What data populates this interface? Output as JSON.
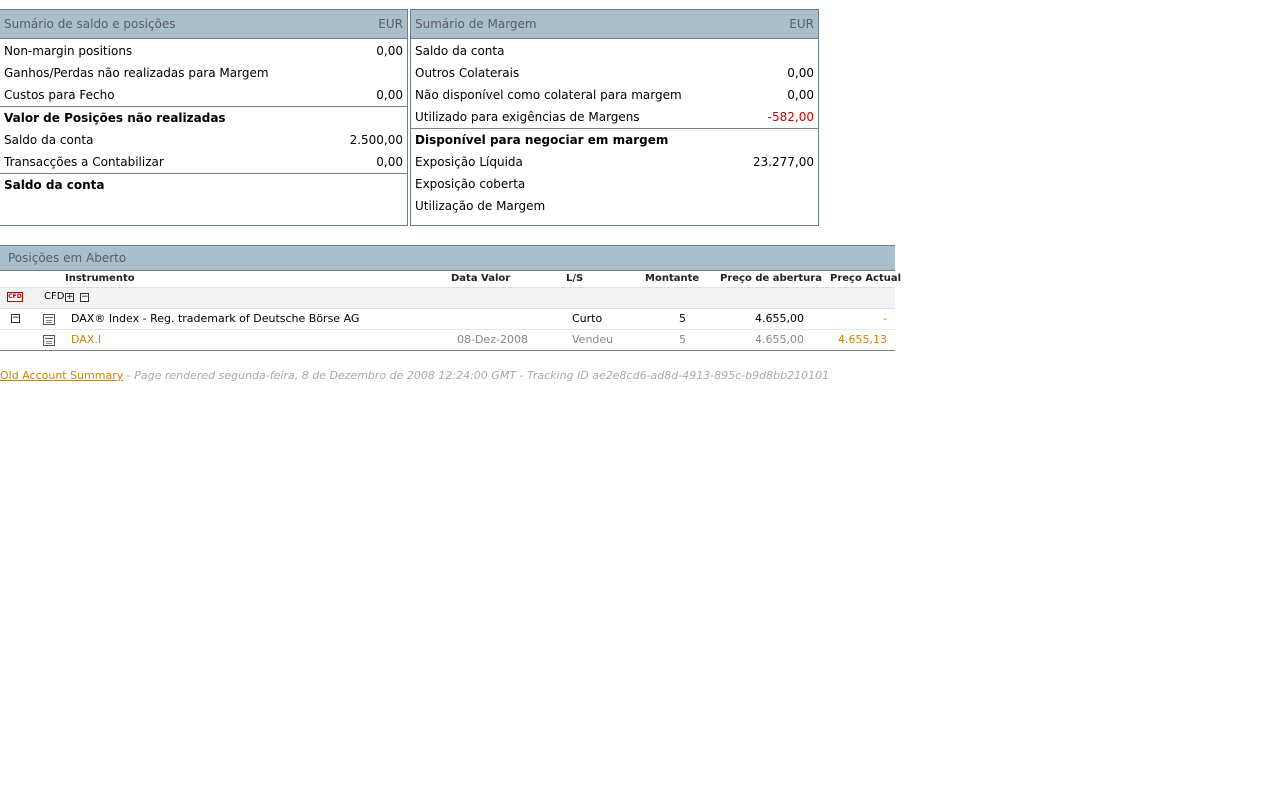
{
  "balance_panel": {
    "title": "Sumário de saldo e posições",
    "currency": "EUR",
    "rows": [
      {
        "label": "Non-margin positions",
        "value": "0,00"
      },
      {
        "label": "Ganhos/Perdas não realizadas para Margem",
        "value": ""
      },
      {
        "label": "Custos para Fecho",
        "value": "0,00"
      },
      {
        "label": "Valor de Posições não realizadas",
        "value": ""
      },
      {
        "label": "Saldo da conta",
        "value": "2.500,00"
      },
      {
        "label": "Transacções a Contabilizar",
        "value": "0,00"
      },
      {
        "label": "Saldo da conta",
        "value": ""
      }
    ]
  },
  "margin_panel": {
    "title": "Sumário de Margem",
    "currency": "EUR",
    "rows": [
      {
        "label": "Saldo da conta",
        "value": ""
      },
      {
        "label": "Outros Colaterais",
        "value": "0,00"
      },
      {
        "label": "Não disponível como colateral para margem",
        "value": "0,00"
      },
      {
        "label": "Utilizado para exigências de Margens",
        "value": "-582,00"
      },
      {
        "label": "Disponível para negociar em margem",
        "value": ""
      },
      {
        "label": "Exposição Líquida",
        "value": "23.277,00"
      },
      {
        "label": "Exposição coberta",
        "value": ""
      },
      {
        "label": "Utilização de Margem",
        "value": ""
      }
    ]
  },
  "positions": {
    "title": "Posições em Aberto",
    "columns": [
      "Instrumento",
      "Data Valor",
      "L/S",
      "Montante",
      "Preço de abertura",
      "Preço Actual"
    ],
    "group": {
      "badge": "CFD",
      "label": "CFD",
      "expand": "+",
      "collapse": "−"
    },
    "instrument_row": {
      "toggle": "−",
      "name": "DAX® Index - Reg. trademark of Deutsche Börse AG",
      "side": "Curto",
      "amount": "5",
      "open_price": "4.655,00",
      "current_price": "-"
    },
    "trade_row": {
      "name": "DAX.I",
      "date": "08-Dez-2008",
      "side": "Vendeu",
      "amount": "5",
      "open_price": "4.655,00",
      "current_price": "4.655,13"
    }
  },
  "footer": {
    "link": "Old Account Summary",
    "text": " - Page rendered segunda-feira, 8 de Dezembro de 2008 12:24:00 GMT - Tracking ID ae2e8cd6-ad8d-4913-895c-b9d8bb210101"
  },
  "colors": {
    "header_bg": "#a9c0cc",
    "negative": "#cc0000",
    "link": "#c58800"
  }
}
